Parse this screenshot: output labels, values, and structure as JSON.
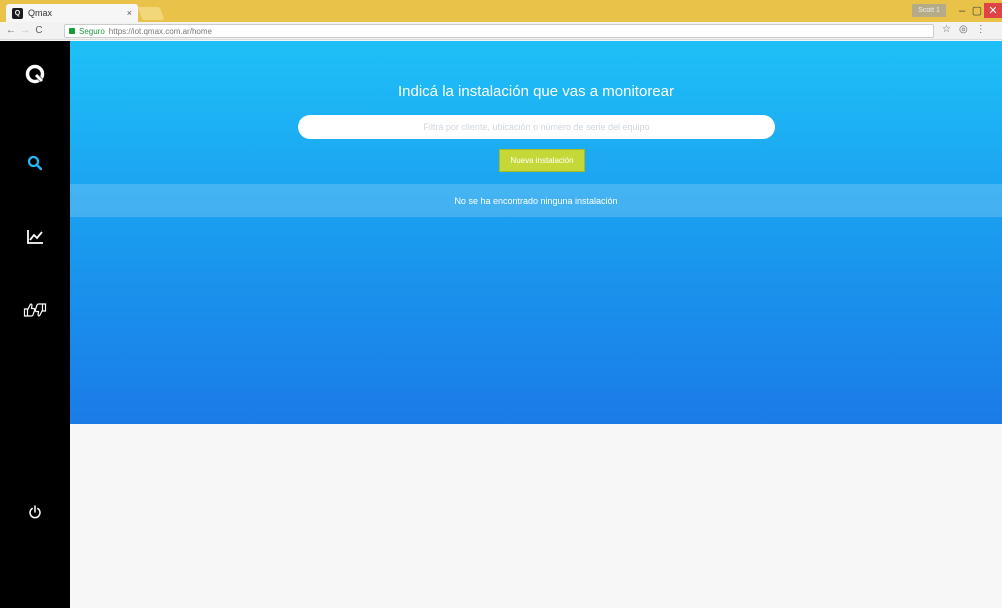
{
  "browser": {
    "tab_title": "Qmax",
    "tab_close": "×",
    "url_secure_label": "Seguro",
    "url": "https://iot.qmax.com.ar/home",
    "window_user": "Scott 1",
    "win_min": "–",
    "win_max": "▢",
    "win_close": "✕"
  },
  "main": {
    "title": "Indicá la instalación que vas a monitorear",
    "search_placeholder": "Filtrá por cliente, ubicación o número de serie del equipo",
    "new_button": "Nueva instalación",
    "empty_message": "No se ha encontrado ninguna instalación"
  },
  "colors": {
    "sidebar": "#000000",
    "accent": "#1ea7f2",
    "button": "#c6d838"
  }
}
